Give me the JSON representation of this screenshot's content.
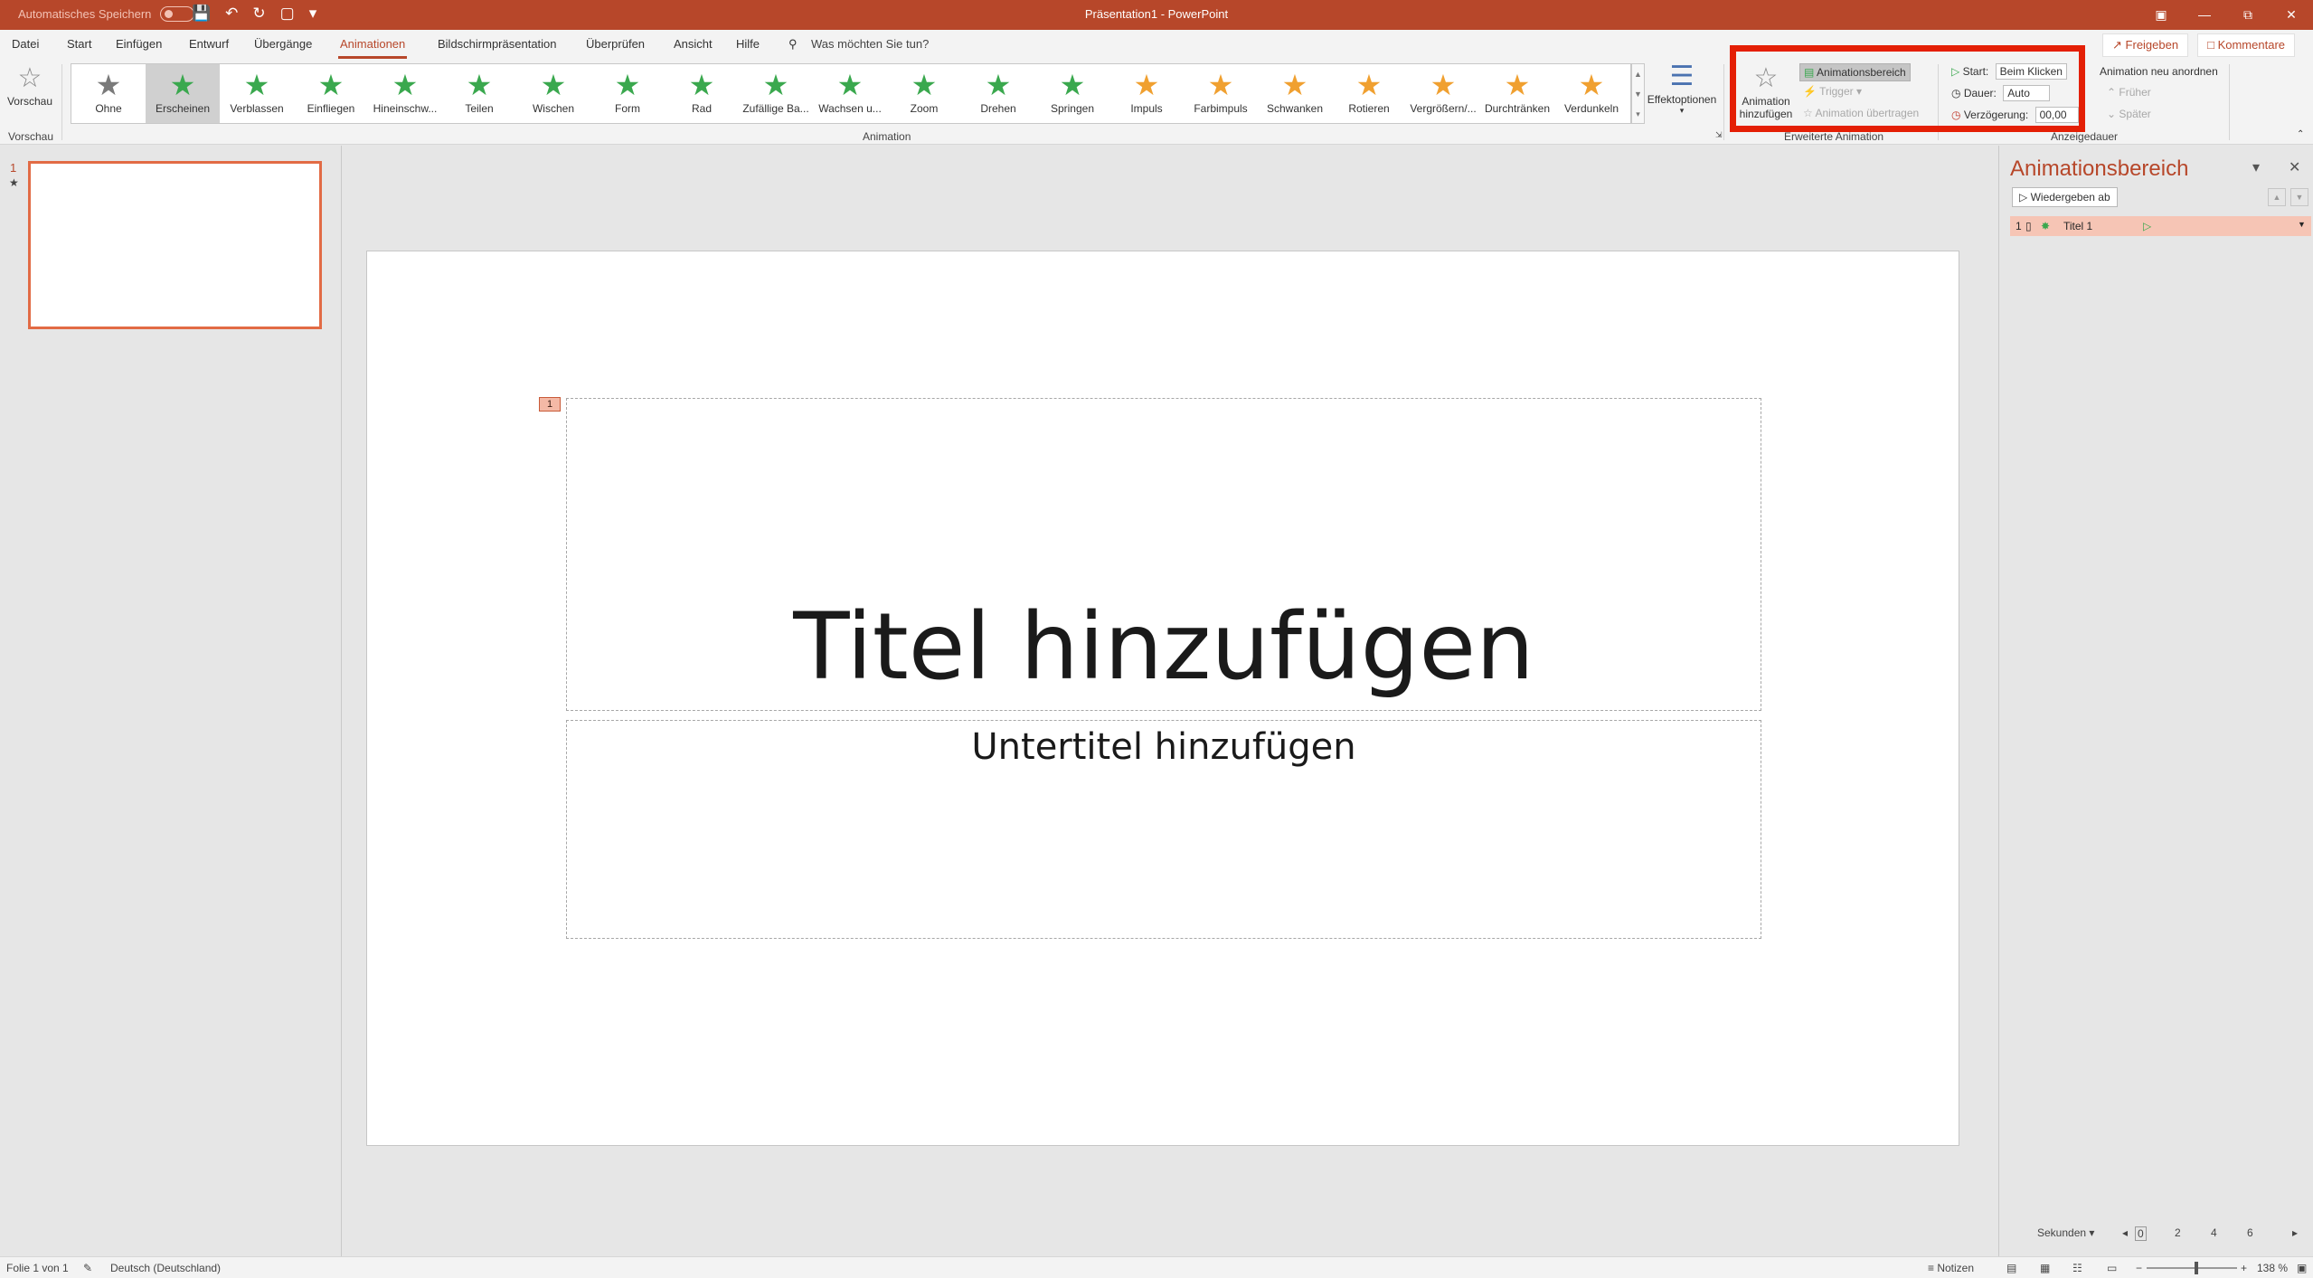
{
  "window": {
    "autosave_label": "Automatisches Speichern",
    "autosave_state": "Aus",
    "title": "Präsentation1 - PowerPoint"
  },
  "menu": {
    "tabs": [
      "Datei",
      "Start",
      "Einfügen",
      "Entwurf",
      "Übergänge",
      "Animationen",
      "Bildschirmpräsentation",
      "Überprüfen",
      "Ansicht",
      "Hilfe"
    ],
    "active_tab": "Animationen",
    "tell_me": "Was möchten Sie tun?",
    "share": "Freigeben",
    "comments": "Kommentare"
  },
  "ribbon": {
    "preview": {
      "label": "Vorschau",
      "group": "Vorschau"
    },
    "animations": [
      {
        "label": "Ohne",
        "color": "#7a7a7a"
      },
      {
        "label": "Erscheinen",
        "color": "#3aa84e"
      },
      {
        "label": "Verblassen",
        "color": "#3aa84e"
      },
      {
        "label": "Einfliegen",
        "color": "#3aa84e"
      },
      {
        "label": "Hineinschw...",
        "color": "#3aa84e"
      },
      {
        "label": "Teilen",
        "color": "#3aa84e"
      },
      {
        "label": "Wischen",
        "color": "#3aa84e"
      },
      {
        "label": "Form",
        "color": "#3aa84e"
      },
      {
        "label": "Rad",
        "color": "#3aa84e"
      },
      {
        "label": "Zufällige Ba...",
        "color": "#3aa84e"
      },
      {
        "label": "Wachsen u...",
        "color": "#3aa84e"
      },
      {
        "label": "Zoom",
        "color": "#3aa84e"
      },
      {
        "label": "Drehen",
        "color": "#3aa84e"
      },
      {
        "label": "Springen",
        "color": "#3aa84e"
      },
      {
        "label": "Impuls",
        "color": "#f0a030"
      },
      {
        "label": "Farbimpuls",
        "color": "#f0a030"
      },
      {
        "label": "Schwanken",
        "color": "#f0a030"
      },
      {
        "label": "Rotieren",
        "color": "#f0a030"
      },
      {
        "label": "Vergrößern/...",
        "color": "#f0a030"
      },
      {
        "label": "Durchtränken",
        "color": "#f0a030"
      },
      {
        "label": "Verdunkeln",
        "color": "#f0a030"
      }
    ],
    "selected_animation": "Erscheinen",
    "animation_group": "Animation",
    "effect_options": "Effektoptionen",
    "add_animation": [
      "Animation",
      "hinzufügen"
    ],
    "animation_pane_btn": "Animationsbereich",
    "trigger": "Trigger",
    "animation_painter": "Animation übertragen",
    "extended_group": "Erweiterte Animation",
    "start_label": "Start:",
    "start_value": "Beim Klicken",
    "duration_label": "Dauer:",
    "duration_value": "Auto",
    "delay_label": "Verzögerung:",
    "delay_value": "00,00",
    "timing_group": "Anzeigedauer",
    "reorder": "Animation neu anordnen",
    "earlier": "Früher",
    "later": "Später"
  },
  "thumbnails": {
    "number": "1",
    "marker": "★"
  },
  "slide": {
    "title": "Titel hinzufügen",
    "subtitle": "Untertitel hinzufügen",
    "anim_tag": "1"
  },
  "animation_pane": {
    "title": "Animationsbereich",
    "play_from": "Wiedergeben ab",
    "item": {
      "number": "1",
      "name": "Titel 1"
    },
    "timeline_unit": "Sekunden",
    "timeline_ticks": [
      "0",
      "2",
      "4",
      "6"
    ]
  },
  "status": {
    "slide_info": "Folie 1 von 1",
    "language": "Deutsch (Deutschland)",
    "notes": "Notizen",
    "zoom": "138 %"
  }
}
